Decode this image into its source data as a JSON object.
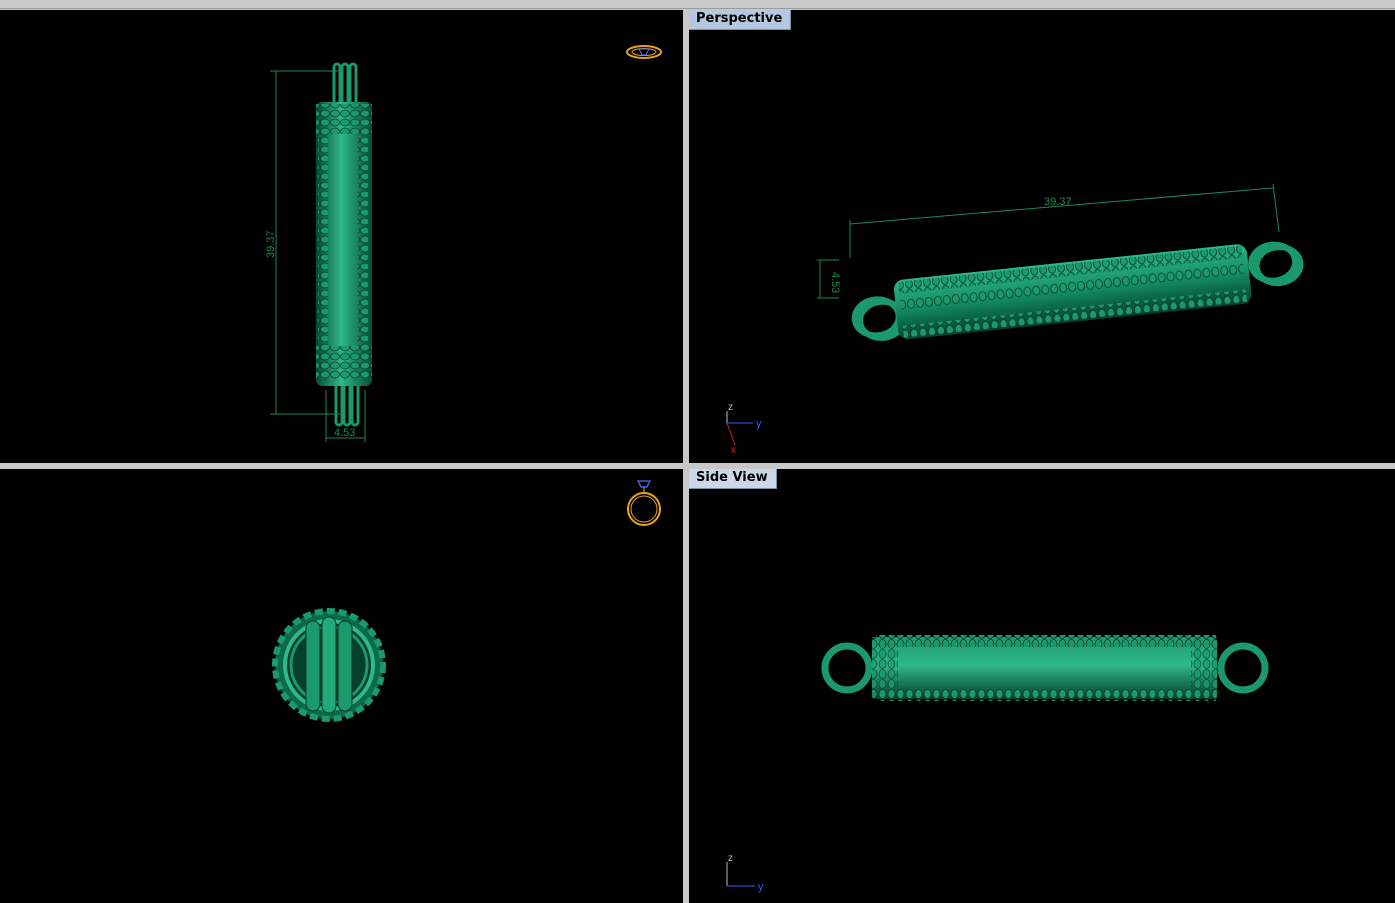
{
  "viewports": {
    "top_left": {
      "dimensions": {
        "length": "39.37",
        "width": "4.53"
      }
    },
    "top_right": {
      "title": "Perspective",
      "dimensions": {
        "length": "39.37",
        "width": "4.53"
      },
      "axes": {
        "z": "z",
        "y": "y",
        "x": "x"
      }
    },
    "bottom_left": {},
    "bottom_right": {
      "title": "Side View",
      "axes": {
        "z": "z",
        "y": "y"
      }
    }
  },
  "colors": {
    "background": "#000000",
    "model": "#0f7a58",
    "model_highlight": "#2fb888",
    "dimension": "#1a8a55",
    "view_icon": "#e8a020",
    "axis_z": "#bbbbbb",
    "axis_y": "#3060ff",
    "axis_x": "#d02020"
  },
  "icons": {
    "top_left": "ring-top-view-icon",
    "bottom_left": "ring-front-view-icon"
  }
}
